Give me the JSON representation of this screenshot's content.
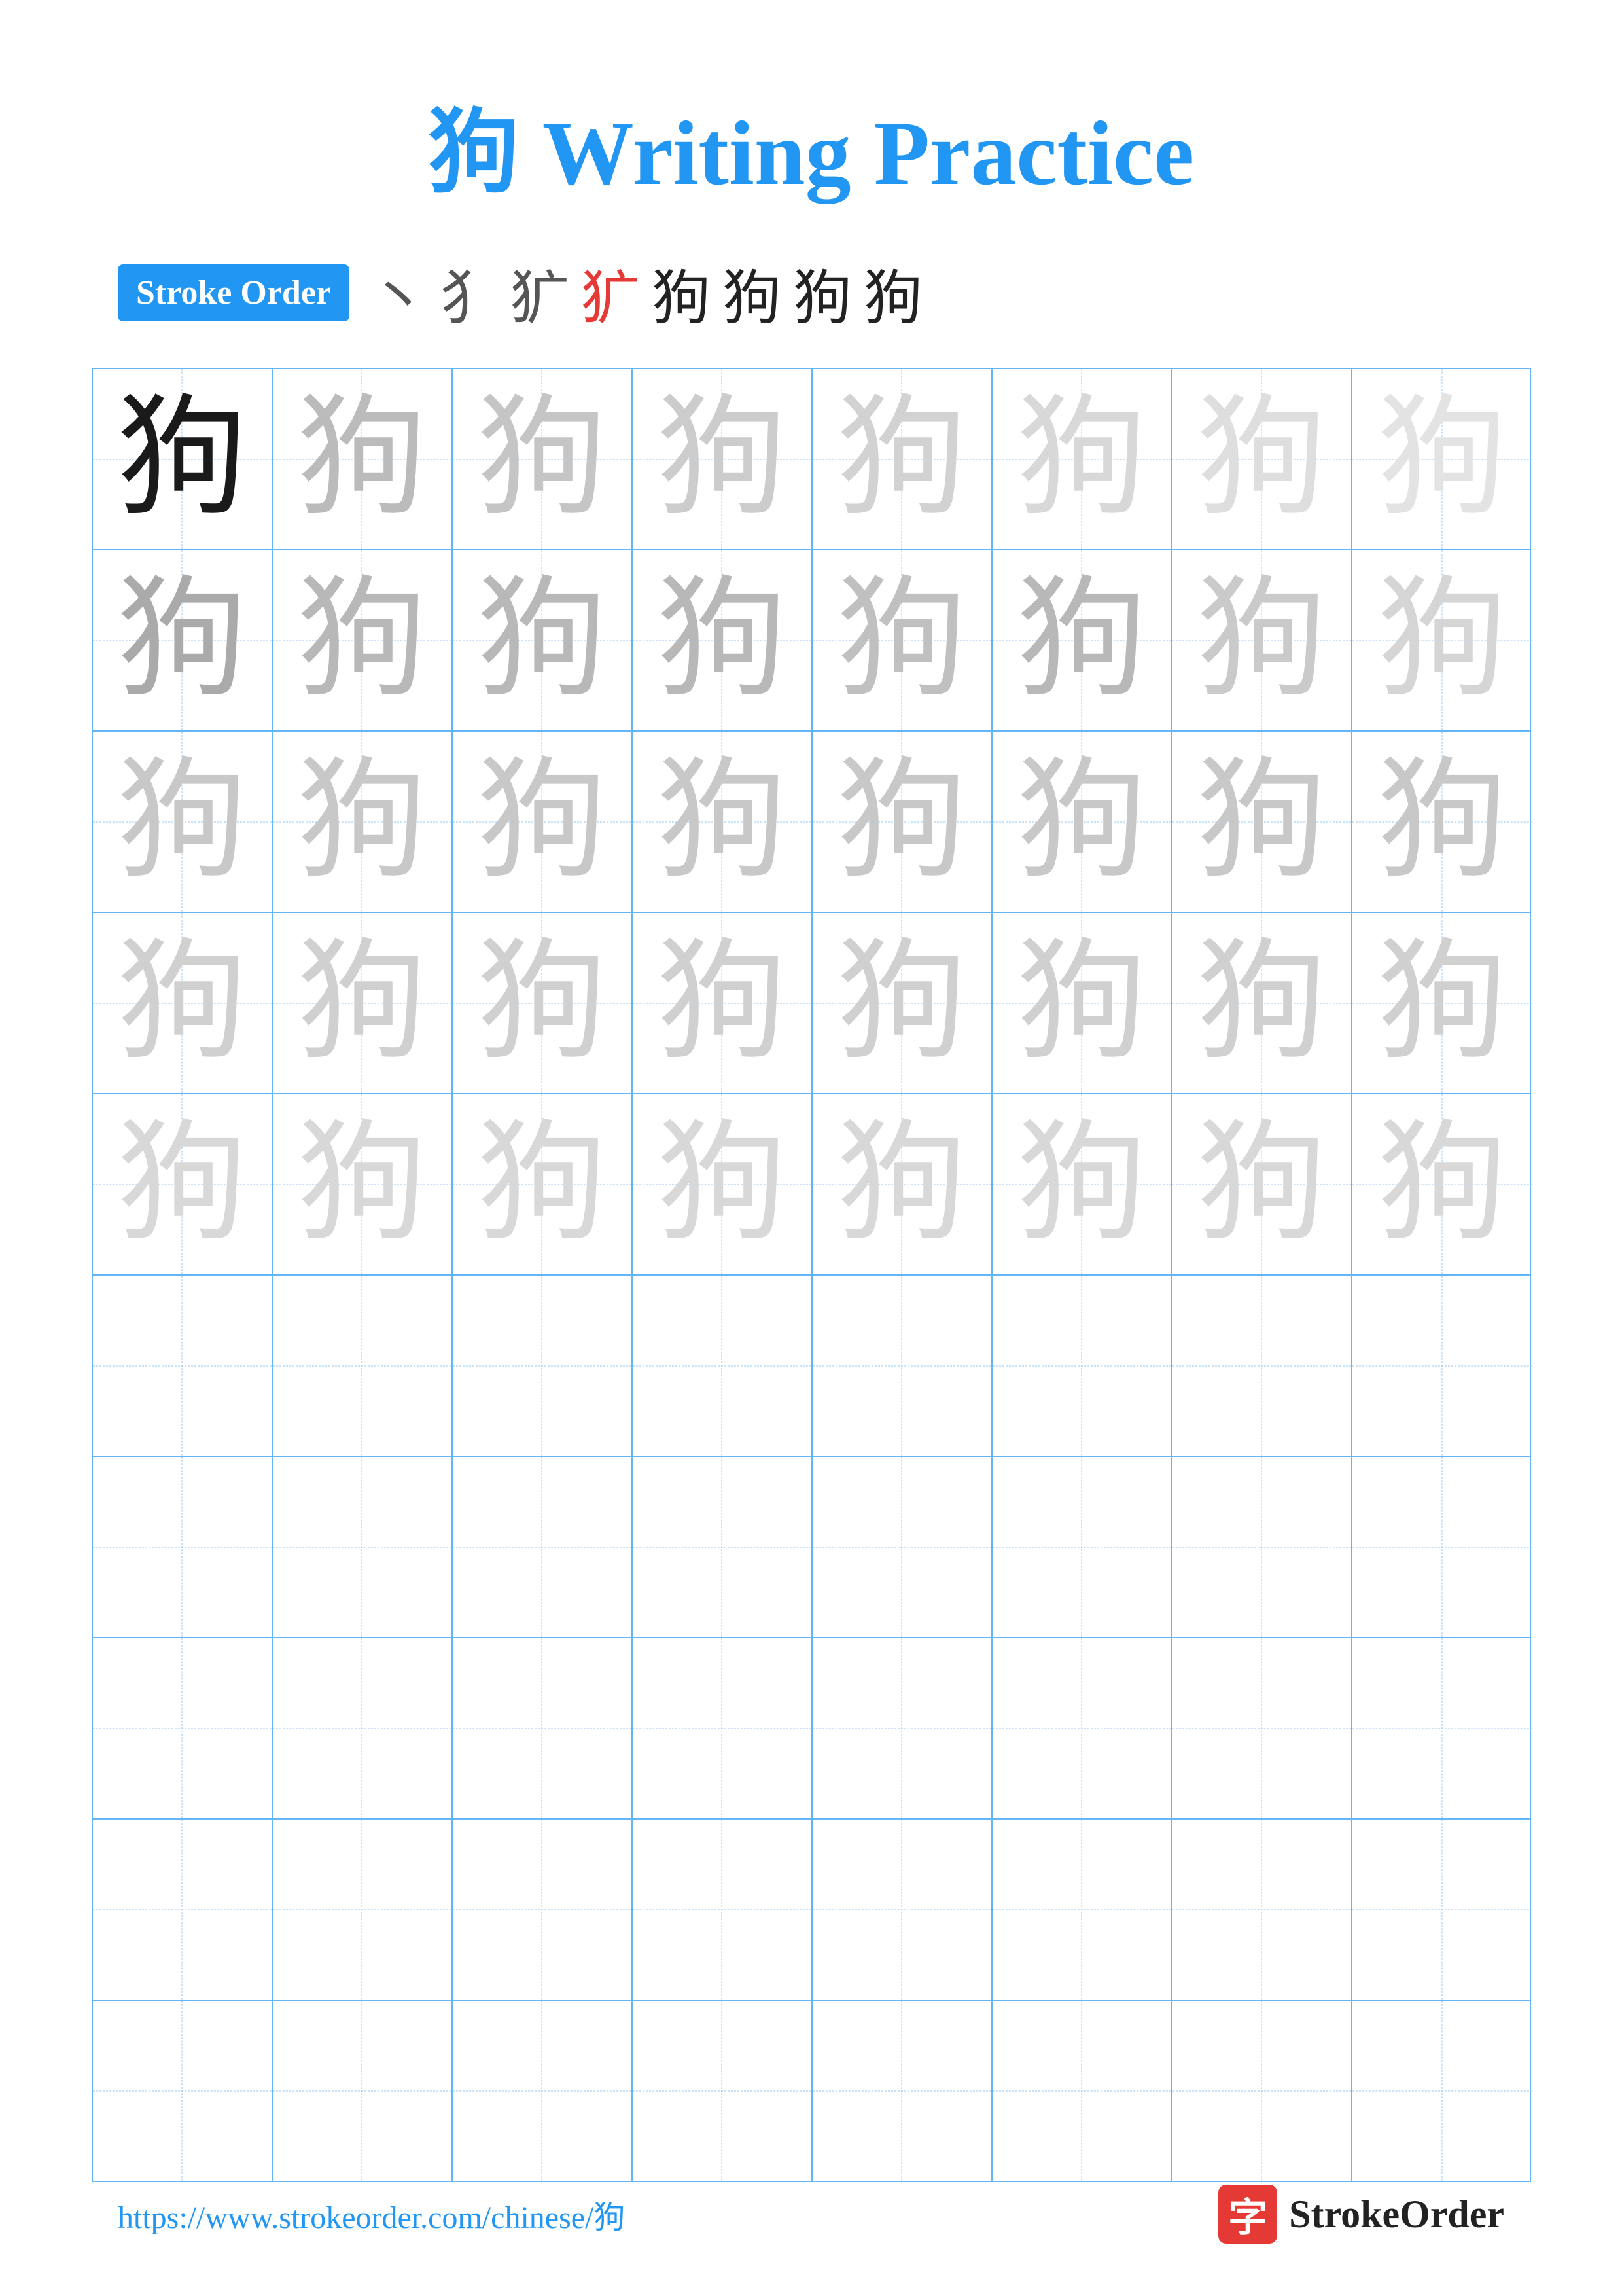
{
  "title": {
    "char": "狗",
    "text": " Writing Practice",
    "full": "狗 Writing Practice"
  },
  "stroke_order": {
    "badge_label": "Stroke Order",
    "strokes": [
      {
        "char": "丶",
        "style": "light"
      },
      {
        "char": "犭",
        "style": "light"
      },
      {
        "char": "犭",
        "style": "light"
      },
      {
        "char": "犷",
        "style": "red"
      },
      {
        "char": "狗",
        "style": "dark"
      },
      {
        "char": "狗",
        "style": "dark"
      },
      {
        "char": "狗",
        "style": "dark"
      },
      {
        "char": "狗",
        "style": "dark"
      }
    ]
  },
  "grid": {
    "char": "狗",
    "cols": 8,
    "practice_rows": 5,
    "empty_rows": 5
  },
  "footer": {
    "url": "https://www.strokeorder.com/chinese/狗",
    "logo_icon": "字",
    "logo_text": "StrokeOrder"
  }
}
